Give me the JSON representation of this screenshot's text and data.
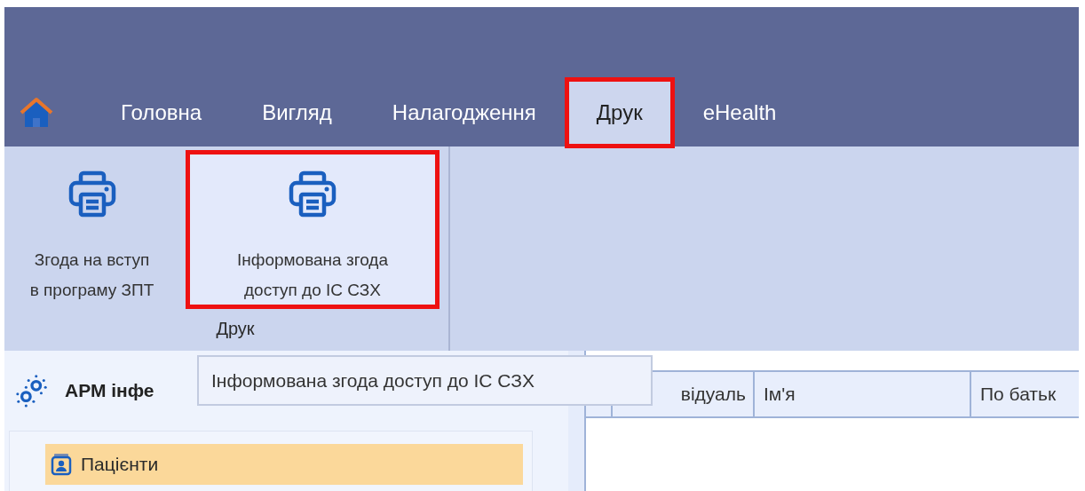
{
  "menu_tabs": [
    {
      "label": "Головна",
      "selected": false,
      "highlighted": false
    },
    {
      "label": "Вигляд",
      "selected": false,
      "highlighted": false
    },
    {
      "label": "Налагодження",
      "selected": false,
      "highlighted": false
    },
    {
      "label": "Друк",
      "selected": true,
      "highlighted": true
    },
    {
      "label": "eHealth",
      "selected": false,
      "highlighted": false
    }
  ],
  "ribbon": {
    "group_label": "Друк",
    "buttons": [
      {
        "label": "Згода на вступ\nв програму ЗПТ",
        "hovered": false,
        "highlighted": false
      },
      {
        "label": "Інформована згода\nдоступ до ІС СЗХ",
        "hovered": true,
        "highlighted": true
      }
    ]
  },
  "tooltip": "Інформована згода доступ до ІС СЗХ",
  "sidebar": {
    "title": "АРМ інфе",
    "items": [
      {
        "label": "Пацієнти",
        "selected": true
      }
    ]
  },
  "table": {
    "columns": [
      "відуаль",
      "Ім'я",
      "По батьк"
    ]
  }
}
